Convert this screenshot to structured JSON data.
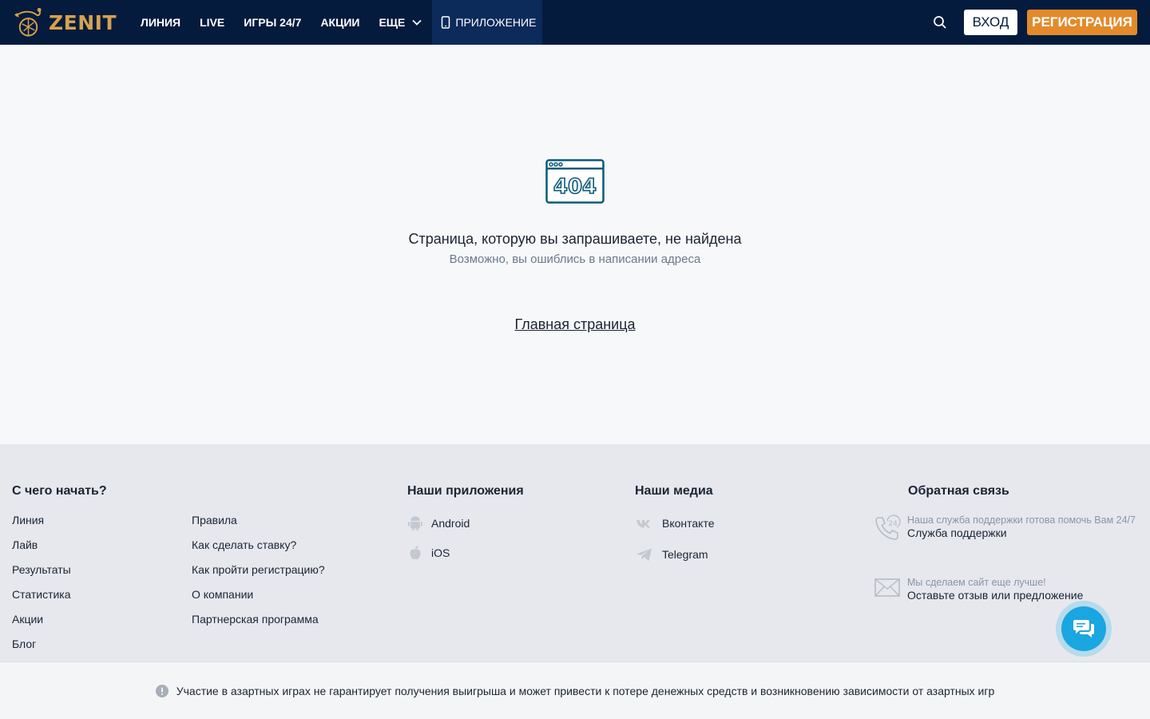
{
  "header": {
    "brand": "ZENIT",
    "nav": [
      {
        "label": "ЛИНИЯ"
      },
      {
        "label": "LIVE"
      },
      {
        "label": "ИГРЫ 24/7"
      },
      {
        "label": "АКЦИИ"
      },
      {
        "label": "ЕЩЕ"
      },
      {
        "label": "ПРИЛОЖЕНИЕ"
      }
    ],
    "login_label": "ВХОД",
    "register_label": "РЕГИСТРАЦИЯ"
  },
  "error": {
    "code": "404",
    "title": "Страница, которую вы запрашиваете, не найдена",
    "subtitle": "Возможно, вы ошиблись в написании адреса",
    "home_link": "Главная страница"
  },
  "footer": {
    "start": {
      "title": "С чего начать?",
      "col1": [
        "Линия",
        "Лайв",
        "Результаты",
        "Статистика",
        "Акции",
        "Блог"
      ],
      "col2": [
        "Правила",
        "Как сделать ставку?",
        "Как пройти регистрацию?",
        "О компании",
        "Партнерская программа"
      ]
    },
    "apps": {
      "title": "Наши приложения",
      "items": [
        "Android",
        "iOS"
      ]
    },
    "media": {
      "title": "Наши медиа",
      "items": [
        "Вконтакте",
        "Telegram"
      ]
    },
    "feedback": {
      "title": "Обратная связь",
      "support_note": "Наша служба поддержки готова помочь Вам 24/7",
      "support_label": "Служба поддержки",
      "review_note": "Мы сделаем сайт еще лучше!",
      "review_label": "Оставьте отзыв или предложение"
    }
  },
  "disclaimer": "Участие в азартных играх не гарантирует получения выигрыша и может привести к потере денежных средств и возникновению зависимости от азартных игр",
  "colors": {
    "header_bg": "#051b3d",
    "accent_orange": "#e38a2a",
    "brand_gold": "#d6a24e",
    "chat_blue": "#1aa6e0",
    "icon_404": "#0b5a7a"
  }
}
